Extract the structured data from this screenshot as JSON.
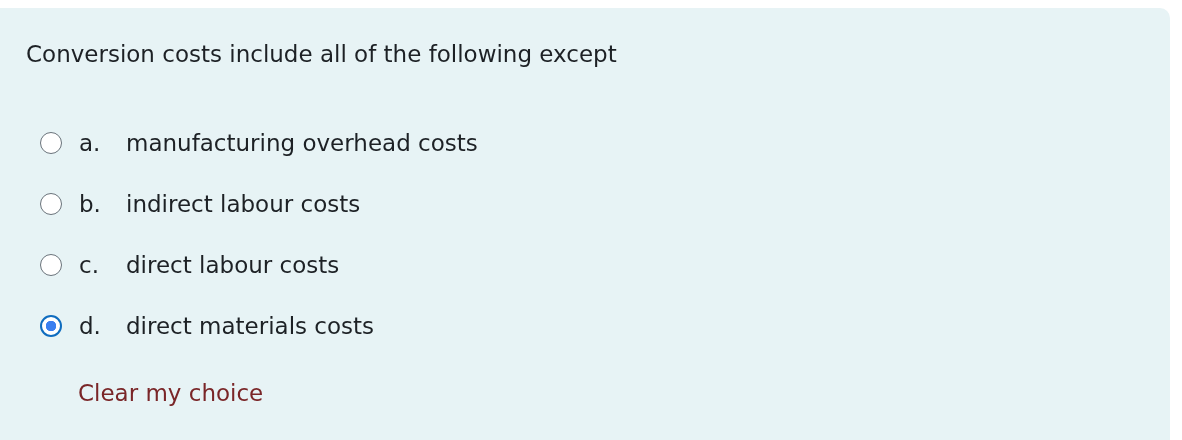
{
  "question": "Conversion costs include all of the following except",
  "options": [
    {
      "letter": "a.",
      "text": "manufacturing overhead costs",
      "selected": false
    },
    {
      "letter": "b.",
      "text": "indirect labour costs",
      "selected": false
    },
    {
      "letter": "c.",
      "text": "direct labour costs",
      "selected": false
    },
    {
      "letter": "d.",
      "text": "direct materials costs",
      "selected": true
    }
  ],
  "clear_link": "Clear my choice"
}
